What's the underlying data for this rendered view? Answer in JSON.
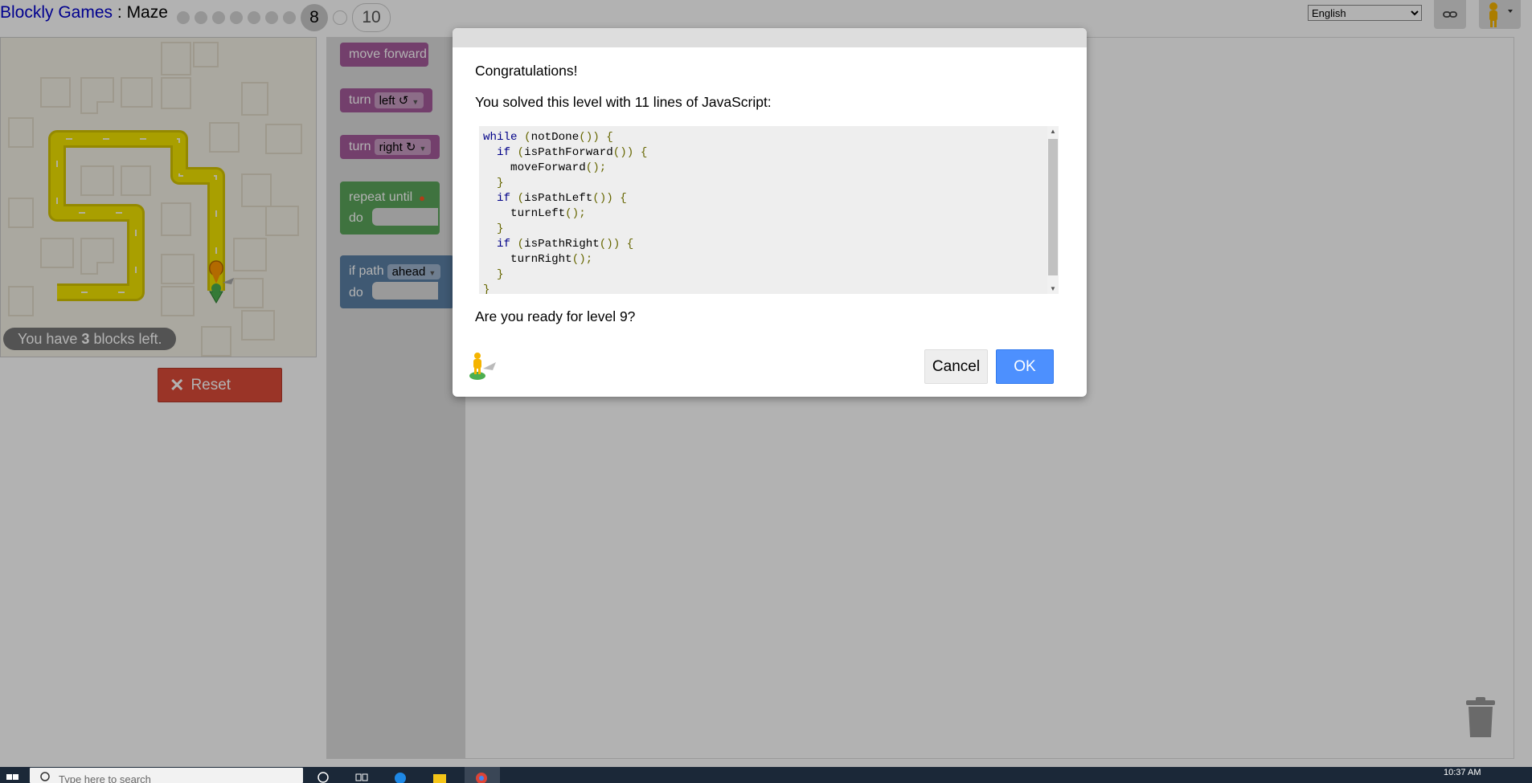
{
  "header": {
    "app_title": "Blockly Games",
    "separator": " : ",
    "page_title": "Maze",
    "current_level": "8",
    "last_level": "10",
    "language": "English",
    "language_options": [
      "English"
    ]
  },
  "maze": {
    "blocks_left_prefix": "You have ",
    "blocks_left_count": "3",
    "blocks_left_suffix": " blocks left.",
    "reset_label": "Reset"
  },
  "toolbox": {
    "move_forward": "move forward",
    "turn_label": "turn",
    "left_option": "left ↺",
    "right_option": "right ↻",
    "repeat_until": "repeat until",
    "do_label": "do",
    "if_path": "if path",
    "ahead_option": "ahead"
  },
  "dialog": {
    "heading": "Congratulations!",
    "solved_text": "You solved this level with 11 lines of JavaScript:",
    "code_lines": [
      "while (notDone()) {",
      "  if (isPathForward()) {",
      "    moveForward();",
      "  }",
      "  if (isPathLeft()) {",
      "    turnLeft();",
      "  }",
      "  if (isPathRight()) {",
      "    turnRight();",
      "  }",
      "}"
    ],
    "question": "Are you ready for level 9?",
    "cancel_label": "Cancel",
    "ok_label": "OK"
  },
  "taskbar": {
    "search_placeholder": "Type here to search",
    "time": "10:37 AM"
  },
  "colors": {
    "link_blue": "#0000cc",
    "ok_blue": "#4d90fe",
    "reset_red": "#dd4b39",
    "block_purple": "#a55b9b",
    "block_green": "#5ba55b",
    "block_blue": "#5b80a5",
    "path_yellow": "#f2e400"
  }
}
